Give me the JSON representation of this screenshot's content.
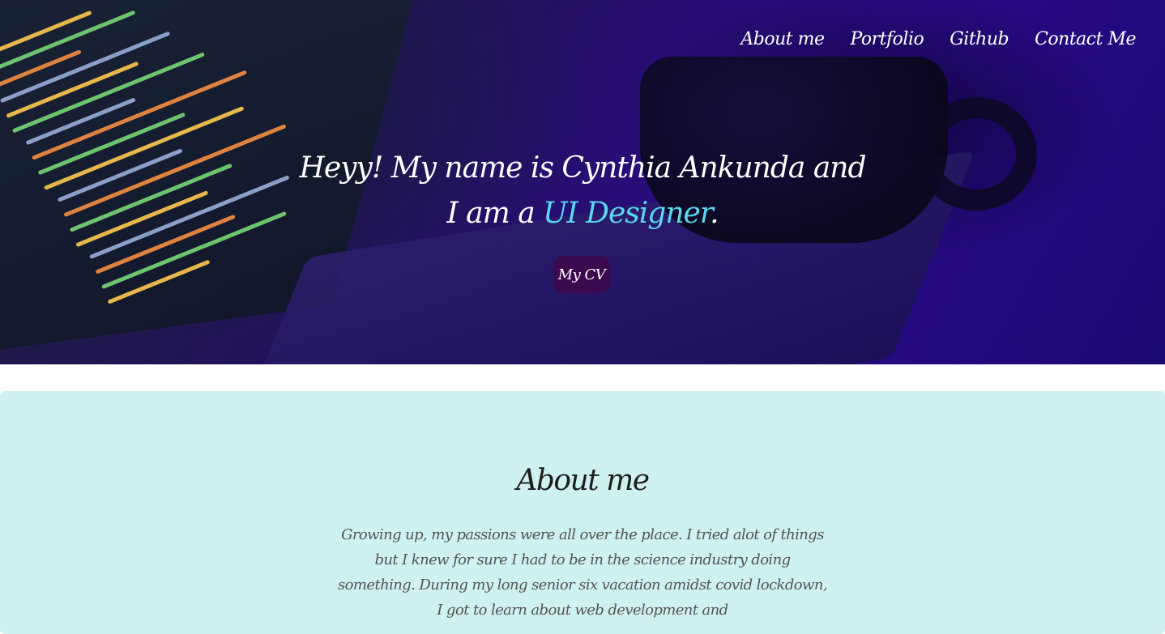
{
  "nav": {
    "items": [
      {
        "label": "About me"
      },
      {
        "label": "Portfolio"
      },
      {
        "label": "Github"
      },
      {
        "label": "Contact Me"
      }
    ]
  },
  "hero": {
    "title_prefix": "Heyy! My name is Cynthia Ankunda and I am a ",
    "role": "UI Designer",
    "title_suffix": ".",
    "cv_label": "My CV"
  },
  "about": {
    "title": "About me",
    "text": "Growing up, my passions were all over the place. I tried alot of things but I knew for sure I had to be in the science industry doing something. During my long senior six vacation amidst covid lockdown, I got to learn about web development and"
  },
  "colors": {
    "role_accent": "#5ad8f0",
    "cv_button_bg": "#3b0a4e",
    "about_bg": "#cff1ef"
  }
}
